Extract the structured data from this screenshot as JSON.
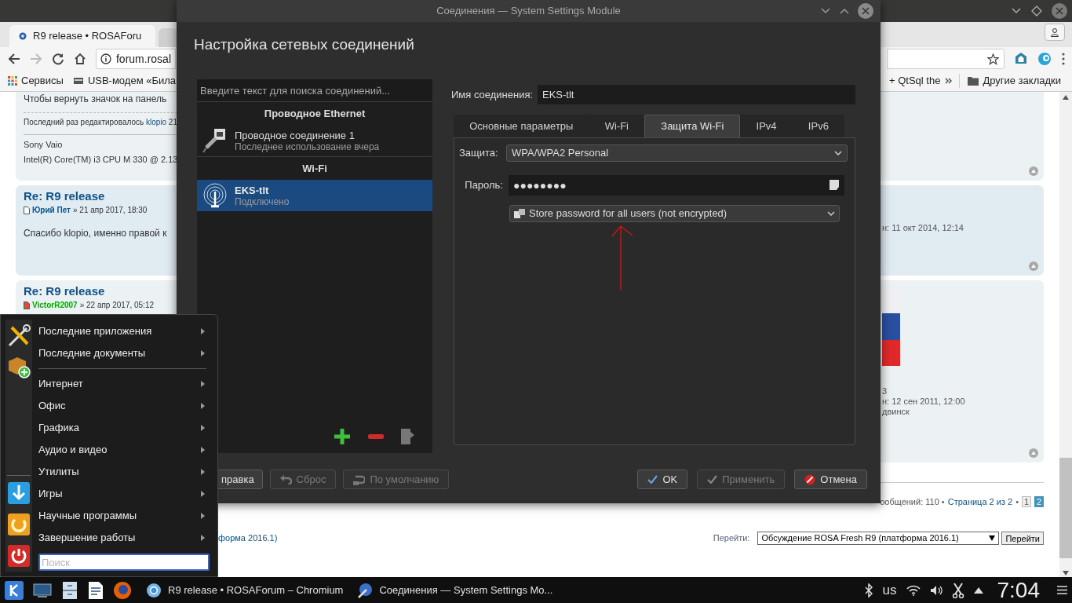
{
  "browser": {
    "tabs": [
      {
        "label": "R9 release • ROSAForu",
        "selected": true
      },
      {
        "selected": false
      }
    ],
    "address": "forum.rosal",
    "bookmarks": [
      {
        "kind": "apps",
        "label": "Сервисы"
      },
      {
        "kind": "modem",
        "label": "USB-модем «Била"
      },
      {
        "kind": "page",
        "label": "+ QtSql the"
      },
      {
        "kind": "folder",
        "label": "Другие закладки"
      }
    ],
    "posts": [
      {
        "body": "Чтобы вернуть значок на панель",
        "edit_note": {
          "text": "Последний раз редактировалось ",
          "user": "klopio",
          "rest": " 21"
        },
        "signature": [
          "Sony Vaio",
          "Intel(R) Core(TM) i3 CPU M 330 @ 2.13"
        ]
      },
      {
        "title": "Re: R9 release",
        "unread": false,
        "author": {
          "name": "Юрий Пет",
          "color": "#105289"
        },
        "date": "» 21 апр 2017, 18:30",
        "body": "Спасибо klopio, именно правой к",
        "profile": [
          "н: 11 окт 2014, 12:14"
        ]
      },
      {
        "title": "Re: R9 release",
        "unread": true,
        "author": {
          "name": "VictorR2007",
          "color": "#00aa00"
        },
        "date": "» 22 апр 2017, 05:12",
        "avatar": true,
        "profile": [
          "3",
          "н: 12 сен 2011, 12:00",
          "двинск"
        ]
      }
    ],
    "pagination": {
      "summary": "ообщений: 110 •",
      "page_link": "Страница 2 из 2",
      "separator": "•",
      "pages": [
        {
          "label": "1",
          "selected": false
        },
        {
          "label": "2",
          "selected": true
        }
      ]
    },
    "forum_link": "форма 2016.1)",
    "jump": {
      "label": "Перейти:",
      "value": "Обсуждение ROSA Fresh R9 (платформа 2016.1)",
      "button": "Перейти"
    }
  },
  "dialog": {
    "title": "Соединения — System Settings Module",
    "heading": "Настройка сетевых соединений",
    "search_placeholder": "Введите текст для поиска соединений...",
    "groups": [
      {
        "name": "Проводное Ethernet",
        "connections": [
          {
            "kind": "wired",
            "name": "Проводное соединение 1",
            "status": "Последнее использование вчера",
            "selected": false
          }
        ]
      },
      {
        "name": "Wi-Fi",
        "connections": [
          {
            "kind": "wifi",
            "name": "EKS-tlt",
            "status": "Подключено",
            "selected": true
          }
        ]
      }
    ],
    "connection_name": {
      "label": "Имя соединения:",
      "value": "EKS-tlt"
    },
    "tabs": [
      {
        "label": "Основные параметры",
        "selected": false
      },
      {
        "label": "Wi-Fi",
        "selected": false
      },
      {
        "label": "Защита Wi-Fi",
        "selected": true
      },
      {
        "label": "IPv4",
        "selected": false
      },
      {
        "label": "IPv6",
        "selected": false
      }
    ],
    "security": {
      "label": "Защита:",
      "value": "WPA/WPA2 Personal"
    },
    "password": {
      "label": "Пароль:",
      "value": "●●●●●●●●"
    },
    "password_storage": "Store password for all users (not encrypted)",
    "left_buttons": [
      {
        "kind": "help",
        "label": "правка",
        "disabled": false
      },
      {
        "kind": "reset",
        "label": "Сброс",
        "disabled": true
      },
      {
        "kind": "defaults",
        "label": "По умолчанию",
        "disabled": true
      }
    ],
    "right_buttons": [
      {
        "kind": "ok",
        "label": "OK",
        "disabled": false
      },
      {
        "kind": "apply",
        "label": "Применить",
        "disabled": true
      },
      {
        "kind": "cancel",
        "label": "Отмена",
        "disabled": false
      }
    ]
  },
  "start_menu": {
    "sections": [
      [
        "Последние приложения",
        "Последние документы"
      ],
      [
        "Интернет",
        "Офис",
        "Графика",
        "Аудио и видео",
        "Утилиты",
        "Игры",
        "Научные программы",
        "Завершение работы"
      ]
    ],
    "search_placeholder": "Поиск"
  },
  "taskbar": {
    "tasks": [
      {
        "kind": "browser",
        "label": "R9 release • ROSAForum – Chromium"
      },
      {
        "kind": "settings",
        "label": "Соединения — System Settings Mo..."
      }
    ],
    "keyboard_layout": "us",
    "clock": "7:04"
  }
}
